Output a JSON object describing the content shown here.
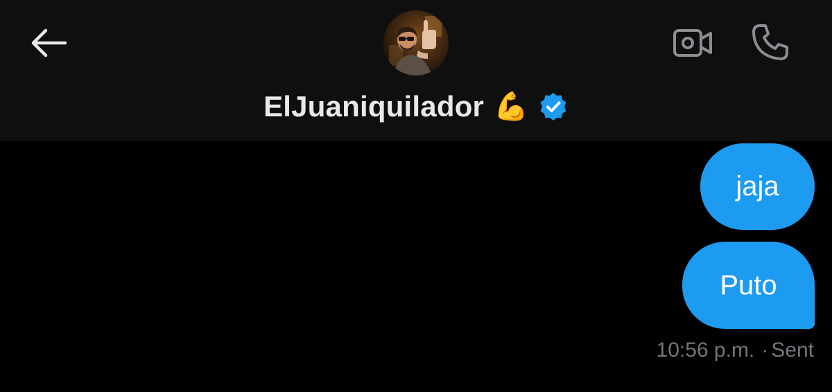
{
  "header": {
    "contact_name": "ElJuaniquilador",
    "name_emoji": "💪",
    "verified": true,
    "icons": {
      "back": "arrow-left-icon",
      "video": "video-camera-icon",
      "call": "phone-icon",
      "verified": "verified-badge-icon"
    },
    "colors": {
      "background": "#0f0f10",
      "text": "#e7e9ea",
      "icon": "#8b8f93",
      "verified": "#1d9bf0"
    }
  },
  "messages": [
    {
      "text": "jaja",
      "direction": "outgoing"
    },
    {
      "text": "Puto",
      "direction": "outgoing"
    }
  ],
  "status": {
    "time": "10:56 p.m.",
    "separator": "·",
    "state": "Sent"
  },
  "colors": {
    "bubble": "#1d9bf0",
    "app_background": "#000000",
    "meta_text": "#71767b"
  }
}
